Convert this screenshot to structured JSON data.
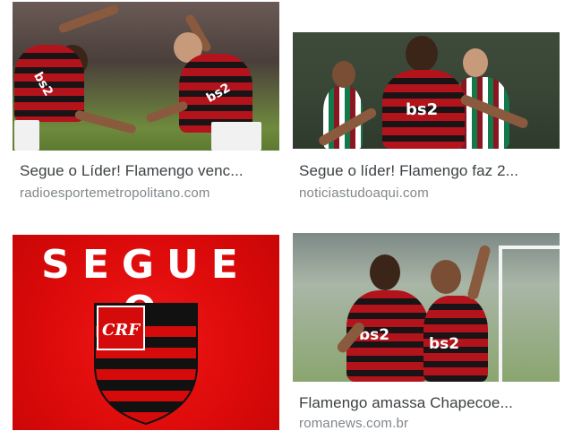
{
  "results": [
    {
      "title": "Segue o Líder! Flamengo venc...",
      "source": "radioesportemetropolitano.com",
      "image": {
        "sponsor_left": "bs2",
        "sponsor_right": "bs2"
      }
    },
    {
      "title": "Segue o líder! Flamengo faz 2...",
      "source": "noticiastudoaqui.com",
      "image": {
        "sponsor": "bs2"
      }
    },
    {
      "title": "",
      "source": "",
      "image": {
        "banner_text": "SEGUE O",
        "crest_letters": "CRF"
      }
    },
    {
      "title": "Flamengo amassa Chapecoe...",
      "source": "romanews.com.br",
      "image": {
        "sponsor_left": "bs2",
        "sponsor_right": "bs2"
      }
    }
  ],
  "colors": {
    "title_text": "#3c4043",
    "source_text": "#80868b",
    "flamengo_red": "#d50a0a",
    "flamengo_black": "#111111"
  }
}
